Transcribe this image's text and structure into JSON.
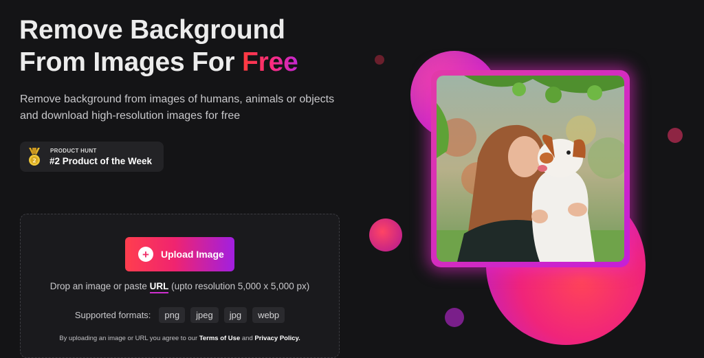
{
  "hero": {
    "title_line1": "Remove Background",
    "title_line2": "From Images For ",
    "title_highlight": "Free",
    "subtitle_line1": "Remove background from images of humans, animals or objects",
    "subtitle_line2": "and download high-resolution images for free"
  },
  "badge": {
    "eyebrow": "PRODUCT HUNT",
    "title": "#2 Product of the Week"
  },
  "upload": {
    "button_label": "Upload Image",
    "drop_prefix": "Drop an image or paste ",
    "url_link": "URL",
    "drop_suffix": " (upto resolution 5,000 x 5,000 px)",
    "formats_label": "Supported formats:",
    "formats": [
      "png",
      "jpeg",
      "jpg",
      "webp"
    ],
    "terms_prefix": "By uploading an image or URL you agree to our ",
    "terms_link": "Terms of Use",
    "terms_and": " and ",
    "privacy_link": "Privacy Policy."
  },
  "colors": {
    "background": "#141416",
    "accent_red": "#ff3e4e",
    "accent_pink": "#f0246f",
    "accent_purple": "#a11fe0"
  }
}
